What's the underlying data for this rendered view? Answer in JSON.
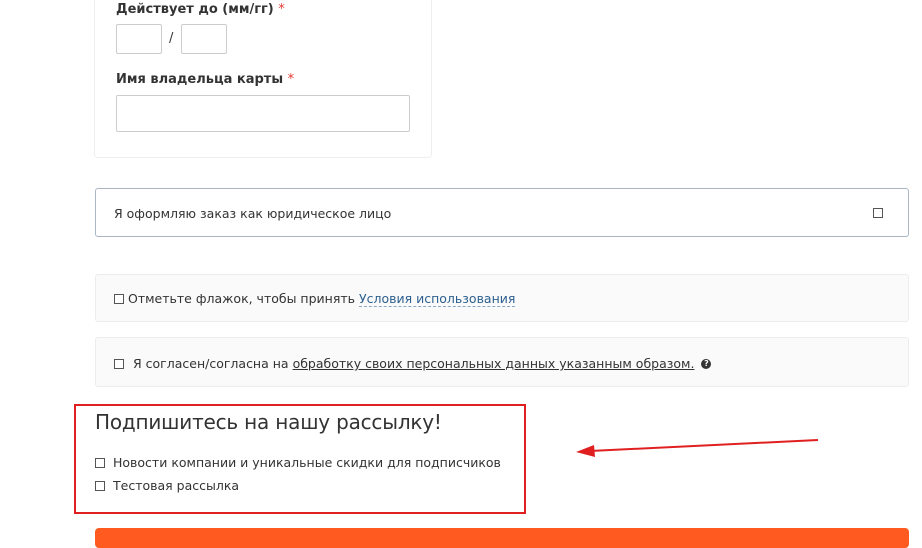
{
  "card": {
    "expiry_label": "Действует до (мм/гг)",
    "expiry_required": "*",
    "expiry_separator": "/",
    "holder_label": "Имя владельца карты",
    "holder_required": "*",
    "expiry_month": "",
    "expiry_year": "",
    "holder_name": ""
  },
  "legal_entity": {
    "label": "Я оформляю заказ как юридическое лицо",
    "checked": false
  },
  "terms": {
    "text": "Отметьте флажок, чтобы принять",
    "link": "Условия использования",
    "checked": false
  },
  "consent": {
    "text": "Я согласен/согласна на",
    "link": "обработку своих персональных данных указанным образом.",
    "info_icon": "question-circle-icon",
    "checked": false
  },
  "newsletter": {
    "title": "Подпишитесь на нашу рассылку!",
    "items": [
      {
        "label": "Новости компании и уникальные скидки для подписчиков",
        "checked": false
      },
      {
        "label": "Тестовая рассылка",
        "checked": false
      }
    ]
  },
  "annotation": {
    "highlight_color": "#e02020",
    "arrow_color": "#e02020"
  },
  "submit": {
    "label": "",
    "color": "#ff5a1f"
  }
}
